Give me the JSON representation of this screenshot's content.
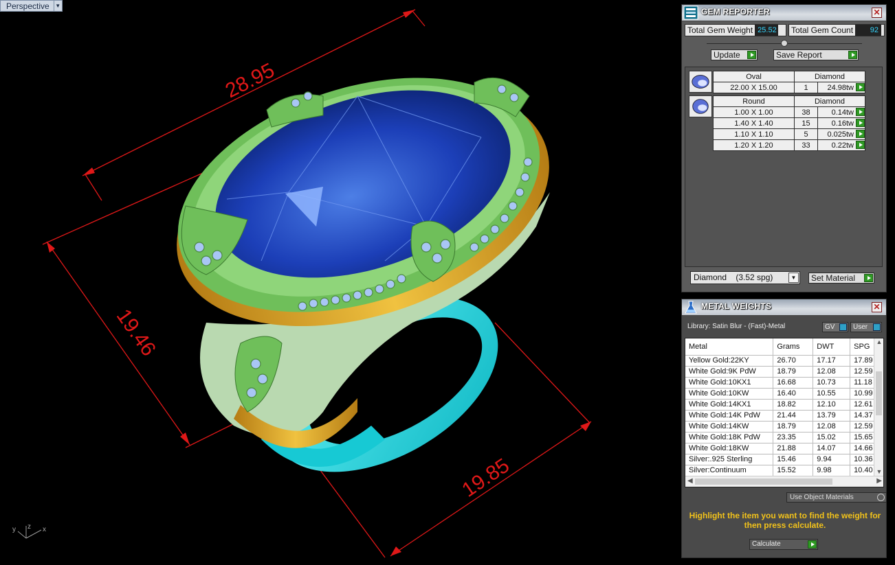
{
  "viewport": {
    "label": "Perspective",
    "dimensions": [
      "28.95",
      "19.46",
      "19.85"
    ],
    "axes": {
      "x": "x",
      "y": "y",
      "z": "z"
    }
  },
  "gem_reporter": {
    "title": "GEM REPORTER",
    "total_weight_label": "Total Gem Weight",
    "total_weight_value": "25.52",
    "total_count_label": "Total Gem Count",
    "total_count_value": "92",
    "update_label": "Update",
    "save_label": "Save Report",
    "groups": [
      {
        "shape": "Oval",
        "material": "Diamond",
        "rows": [
          {
            "size": "22.00 X 15.00",
            "qty": "1",
            "weight": "24.98tw"
          }
        ]
      },
      {
        "shape": "Round",
        "material": "Diamond",
        "rows": [
          {
            "size": "1.00 X 1.00",
            "qty": "38",
            "weight": "0.14tw"
          },
          {
            "size": "1.40 X 1.40",
            "qty": "15",
            "weight": "0.16tw"
          },
          {
            "size": "1.10 X 1.10",
            "qty": "5",
            "weight": "0.025tw"
          },
          {
            "size": "1.20 X 1.20",
            "qty": "33",
            "weight": "0.22tw"
          }
        ]
      }
    ],
    "material_select": "Diamond    (3.52 spg)",
    "set_material_label": "Set Material"
  },
  "metal_weights": {
    "title": "METAL WEIGHTS",
    "library": "Library: Satin Blur - (Fast)-Metal",
    "gv_label": "GV",
    "user_label": "User",
    "columns": [
      "Metal",
      "Grams",
      "DWT",
      "SPG"
    ],
    "rows": [
      [
        "Yellow Gold:22KY",
        "26.70",
        "17.17",
        "17.89"
      ],
      [
        "White Gold:9K PdW",
        "18.79",
        "12.08",
        "12.59"
      ],
      [
        "White Gold:10KX1",
        "16.68",
        "10.73",
        "11.18"
      ],
      [
        "White Gold:10KW",
        "16.40",
        "10.55",
        "10.99"
      ],
      [
        "White Gold:14KX1",
        "18.82",
        "12.10",
        "12.61"
      ],
      [
        "White Gold:14K PdW",
        "21.44",
        "13.79",
        "14.37"
      ],
      [
        "White Gold:14KW",
        "18.79",
        "12.08",
        "12.59"
      ],
      [
        "White Gold:18K PdW",
        "23.35",
        "15.02",
        "15.65"
      ],
      [
        "White Gold:18KW",
        "21.88",
        "14.07",
        "14.66"
      ],
      [
        "Silver:.925 Sterling",
        "15.46",
        "9.94",
        "10.36"
      ],
      [
        "Silver:Continuum",
        "15.52",
        "9.98",
        "10.40"
      ]
    ],
    "use_object_materials": "Use Object Materials",
    "hint": "Highlight the item you want to find the weight for then press calculate.",
    "calculate_label": "Calculate"
  },
  "colors": {
    "dimension_red": "#e01818",
    "gem_blue": "#1c3fb8",
    "metal_green": "#6fbf5a",
    "shank_cyan": "#19d6e0",
    "gold": "#d9a12a",
    "hint_yellow": "#f2c21a"
  }
}
